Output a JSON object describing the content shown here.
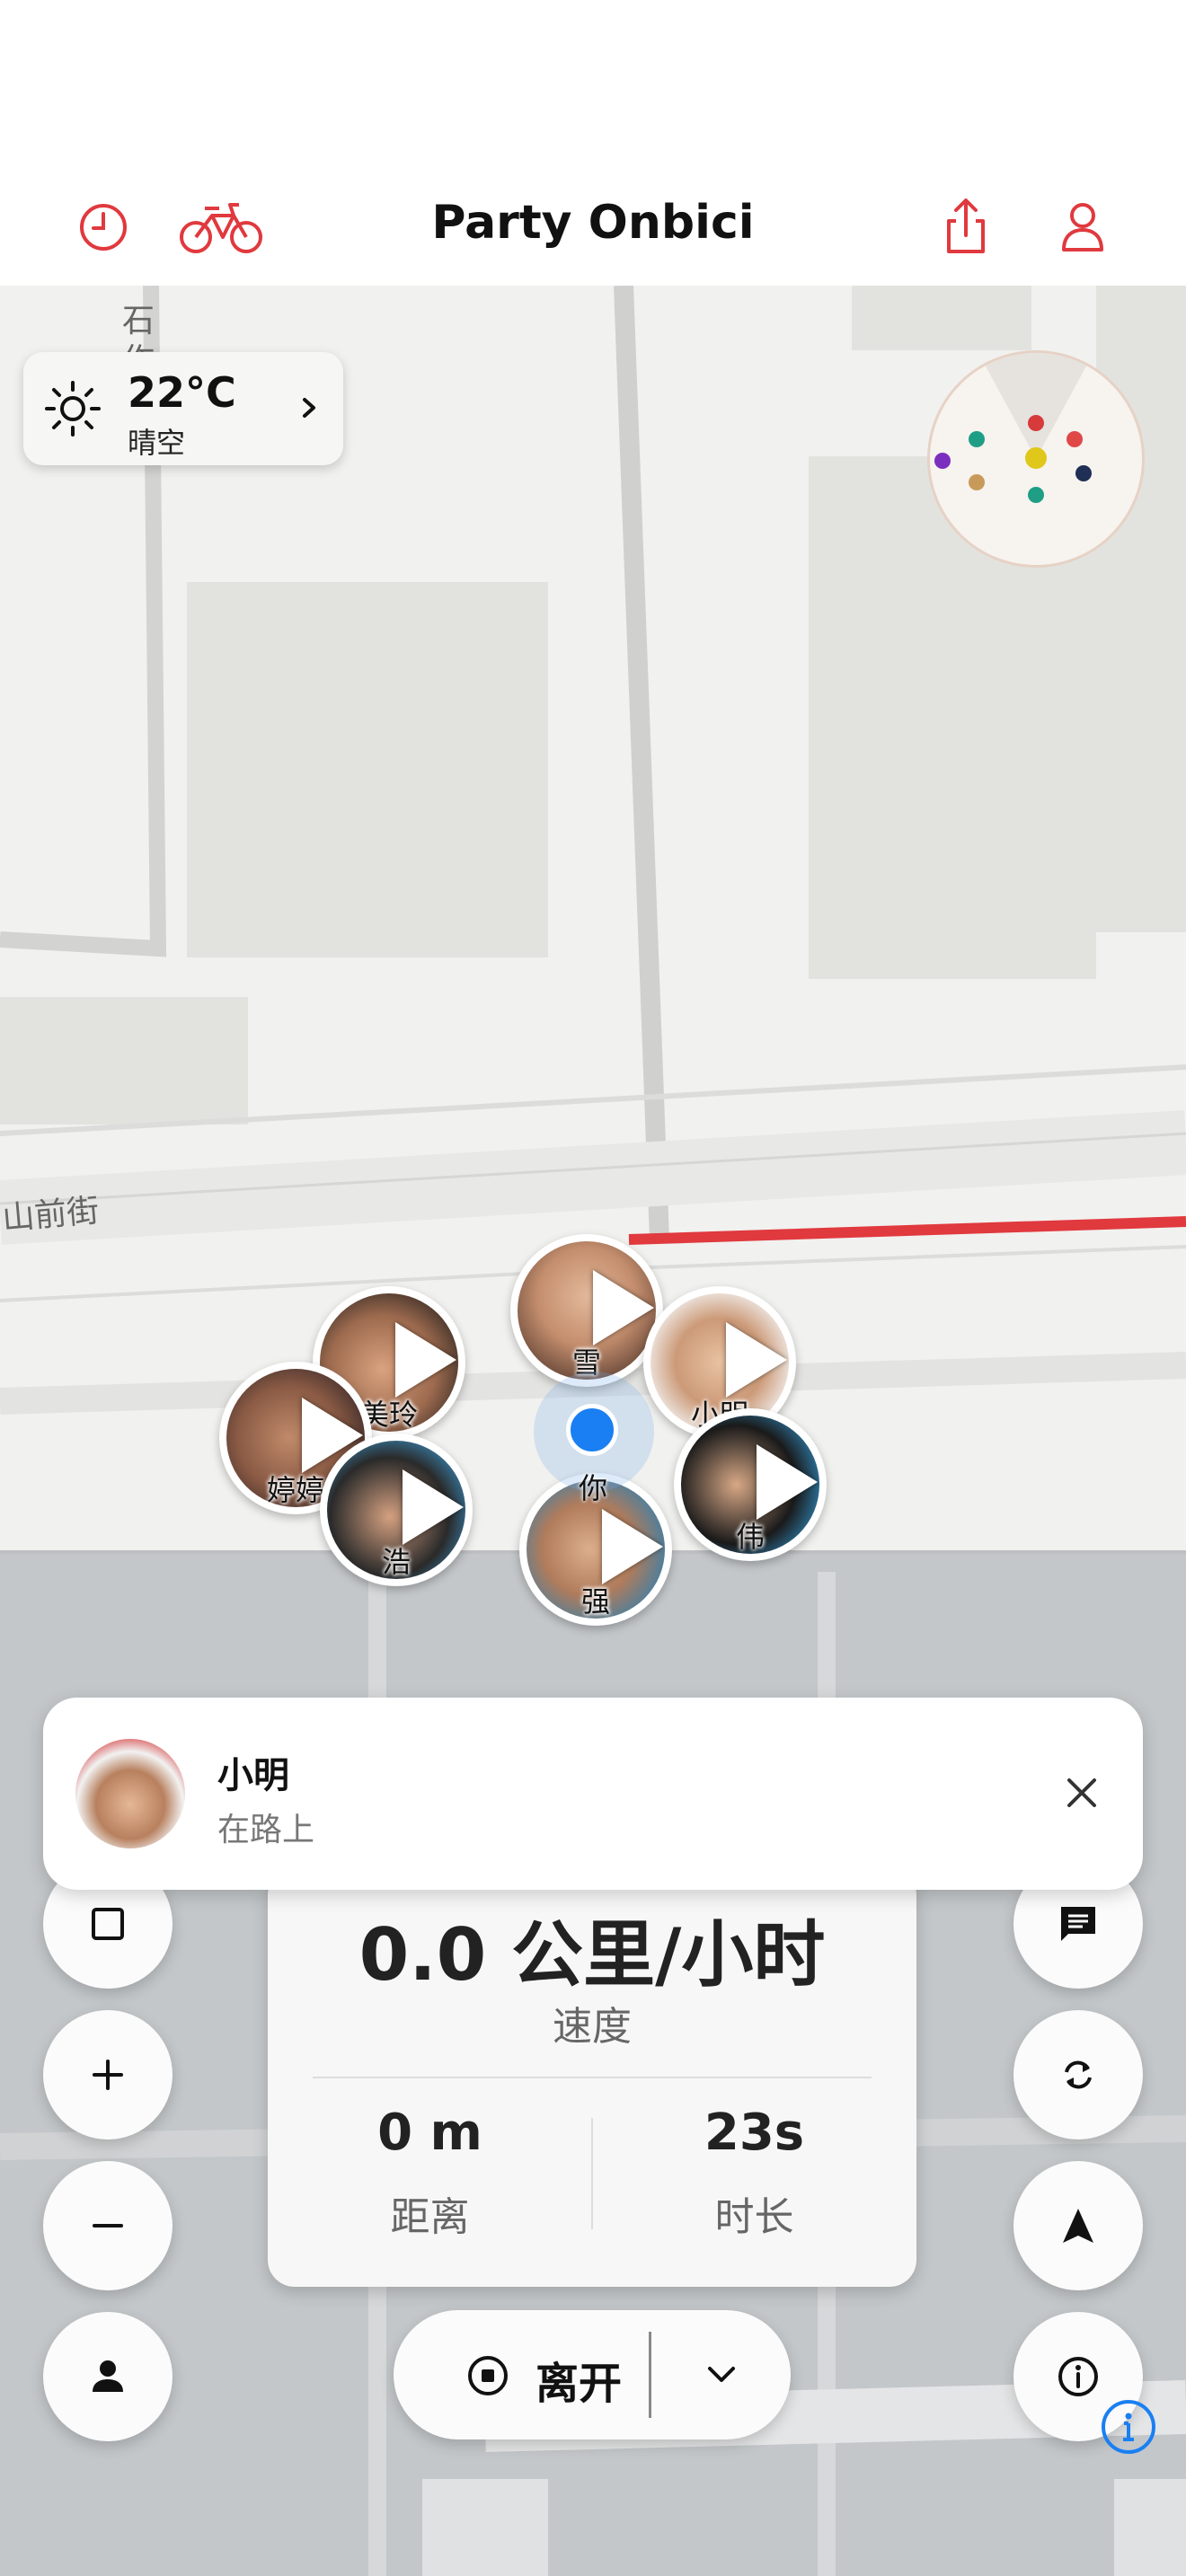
{
  "header": {
    "title": "Party Onbici",
    "icons": [
      "history-icon",
      "bicycle-icon",
      "share-icon",
      "profile-icon"
    ],
    "accent_color": "#e0393e"
  },
  "map": {
    "street_labels": [
      "石作胡同",
      "山前街"
    ]
  },
  "weather": {
    "temperature": "22°C",
    "condition": "晴空"
  },
  "radar": {
    "dot_colors": [
      "#d63a3a",
      "#1f9e86",
      "#e0c81a",
      "#e04848",
      "#7b2fbf",
      "#c89a5a",
      "#1f9e86",
      "#1f2f55"
    ]
  },
  "riders": [
    {
      "name": "雪"
    },
    {
      "name": "美玲"
    },
    {
      "name": "小明"
    },
    {
      "name": "婷婷"
    },
    {
      "name": "伟"
    },
    {
      "name": "浩"
    },
    {
      "name": "强"
    }
  ],
  "self": {
    "label": "你"
  },
  "notification": {
    "name": "小明",
    "status": "在路上"
  },
  "stats": {
    "speed": "0.0 公里/小时",
    "speed_label": "速度",
    "distance": "0 m",
    "distance_label": "距离",
    "duration": "23s",
    "duration_label": "时长"
  },
  "controls": {
    "leave_label": "离开"
  }
}
